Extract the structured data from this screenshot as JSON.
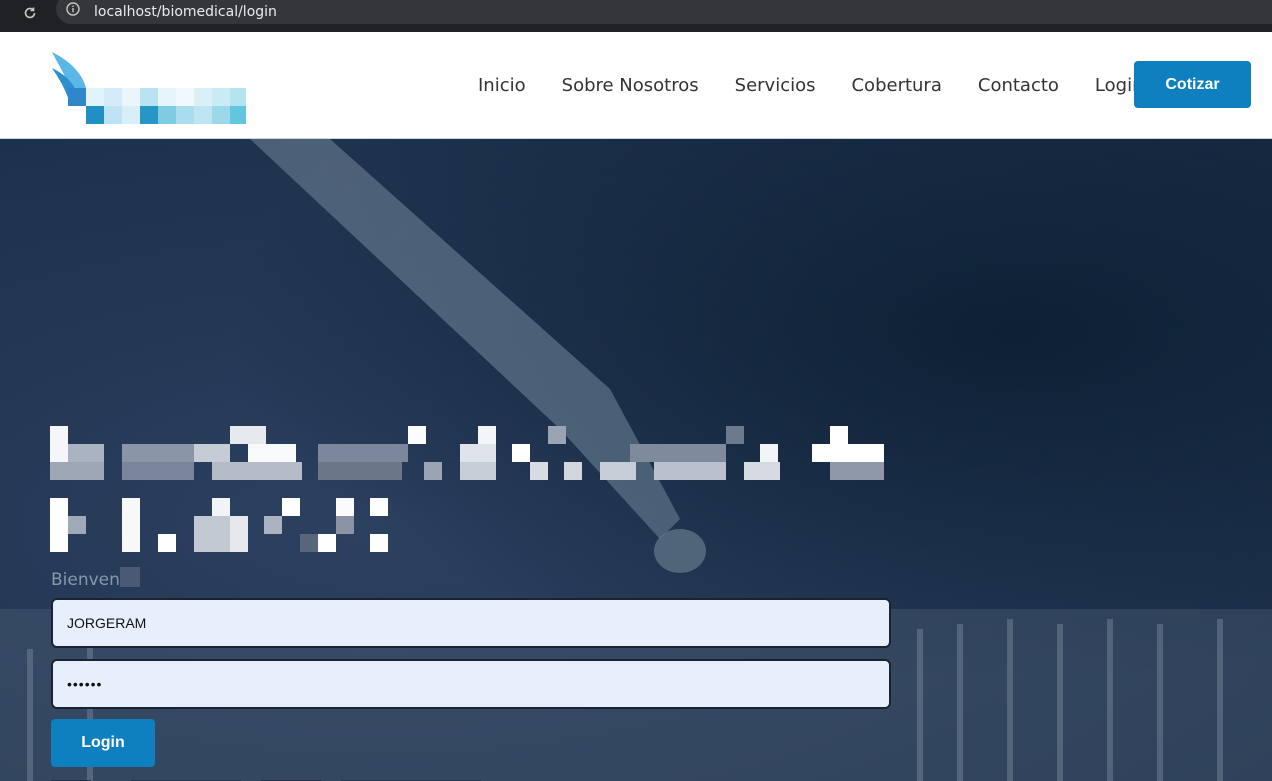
{
  "browser": {
    "url": "localhost/biomedical/login",
    "reload_icon": "reload-icon",
    "info_icon": "info-icon"
  },
  "header": {
    "logo_icon": "wing-logo-icon",
    "nav": [
      "Inicio",
      "Sobre Nosotros",
      "Servicios",
      "Cobertura",
      "Contacto",
      "Login"
    ],
    "cta_label": "Cotizar"
  },
  "login": {
    "welcome_text": "Bienven",
    "username_value": "JORGERAM",
    "password_value": "••••••",
    "submit_label": "Login"
  },
  "colors": {
    "accent": "#0e80bf",
    "field_bg": "#e8effc",
    "header_bg": "#ffffff"
  }
}
